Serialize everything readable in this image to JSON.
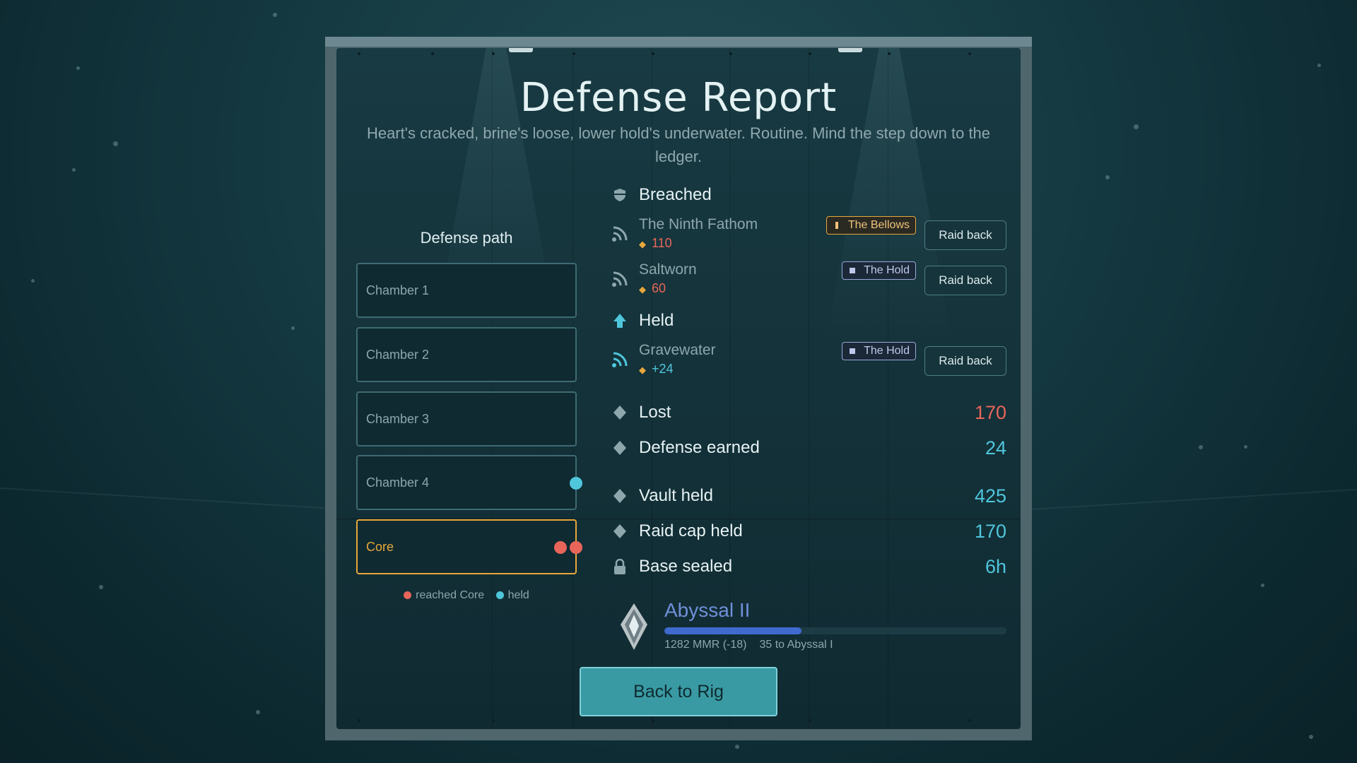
{
  "header": {
    "title": "Defense Report",
    "subtitle": "Heart's cracked, brine's loose, lower hold's underwater. Routine. Mind the step down to the ledger."
  },
  "defense_path": {
    "heading": "Defense path",
    "chambers": [
      "Chamber 1",
      "Chamber 2",
      "Chamber 3",
      "Chamber 4",
      "Core"
    ],
    "legend": {
      "reached": "reached Core",
      "held": "held"
    }
  },
  "breached": {
    "label": "Breached",
    "raids": [
      {
        "name": "The Ninth Fathom",
        "amount": "110",
        "room": "The Bellows",
        "button": "Raid back"
      },
      {
        "name": "Saltworn",
        "amount": "60",
        "room": "The Hold",
        "button": "Raid back"
      }
    ]
  },
  "held": {
    "label": "Held",
    "raids": [
      {
        "name": "Gravewater",
        "amount": "+24",
        "room": "The Hold",
        "button": "Raid back"
      }
    ]
  },
  "stats": {
    "lost": {
      "label": "Lost",
      "value": "170"
    },
    "defense_earned": {
      "label": "Defense earned",
      "value": "24"
    },
    "vault_held": {
      "label": "Vault held",
      "value": "425"
    },
    "raid_cap_held": {
      "label": "Raid cap held",
      "value": "170"
    },
    "base_sealed": {
      "label": "Base sealed",
      "value": "6h"
    }
  },
  "rank": {
    "name": "Abyssal II",
    "mmr": "1282 MMR (-18)",
    "to_next": "35 to Abyssal I",
    "progress": 0.4
  },
  "footer": {
    "back_button": "Back to Rig"
  },
  "colors": {
    "accent_teal": "#4fc6dc",
    "loss_red": "#e8655a",
    "gold": "#e8a73c",
    "rank_blue": "#6f8fd8"
  }
}
